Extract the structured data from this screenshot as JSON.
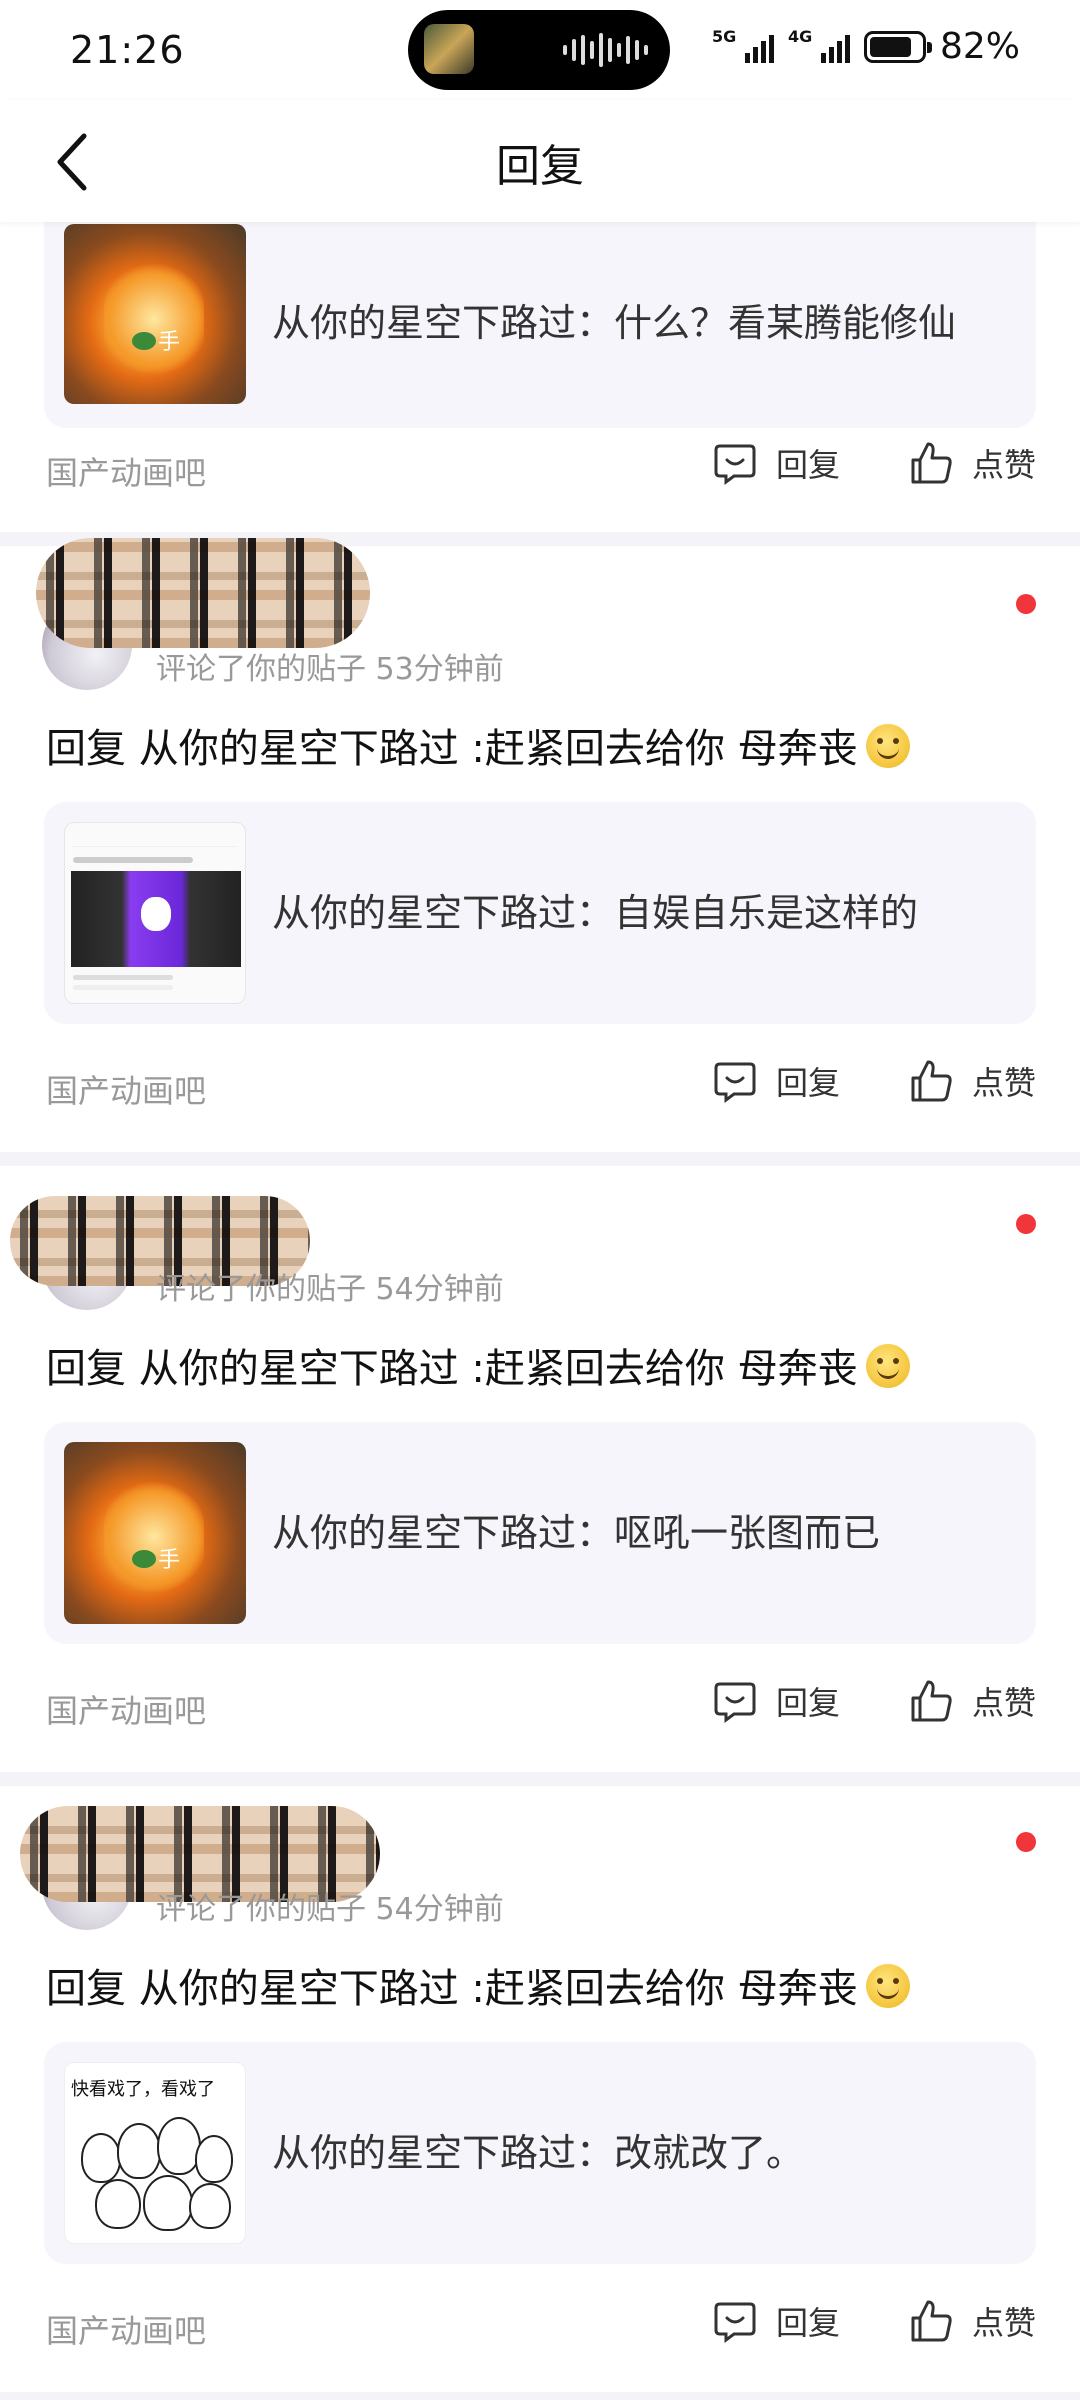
{
  "status_bar": {
    "time": "21:26",
    "signal1_label": "5G",
    "signal2_label": "4G",
    "battery_percent": "82%",
    "battery_level": 0.82
  },
  "header": {
    "title": "回复"
  },
  "posts": [
    {
      "quote_text": "从你的星空下路过：什么？看某腾能修仙",
      "forum": "国产动画吧",
      "reply_label": "回复",
      "like_label": "点赞"
    },
    {
      "meta": "评论了你的贴子  53分钟前",
      "reply_text": "回复 从你的星空下路过 :赶紧回去给你 母奔丧",
      "quote_text": "从你的星空下路过：自娱自乐是这样的",
      "forum": "国产动画吧",
      "reply_label": "回复",
      "like_label": "点赞"
    },
    {
      "meta": "评论了你的贴子  54分钟前",
      "reply_text": "回复 从你的星空下路过 :赶紧回去给你 母奔丧",
      "quote_text": "从你的星空下路过：呕吼一张图而已",
      "forum": "国产动画吧",
      "reply_label": "回复",
      "like_label": "点赞"
    },
    {
      "meta": "评论了你的贴子  54分钟前",
      "reply_text": "回复 从你的星空下路过 :赶紧回去给你 母奔丧",
      "quote_text": "从你的星空下路过：改就改了。",
      "thumb_caption": "快看戏了，看戏了",
      "forum": "国产动画吧",
      "reply_label": "回复",
      "like_label": "点赞"
    }
  ],
  "icons": {
    "back": "chevron-left-icon",
    "reply": "comment-bubble-icon",
    "like": "thumbs-up-icon",
    "smile": "smile-emoji-icon"
  },
  "colors": {
    "unread_dot": "#f0363a",
    "quote_bg": "#f5f5fb",
    "separator": "#f4f4f8"
  }
}
